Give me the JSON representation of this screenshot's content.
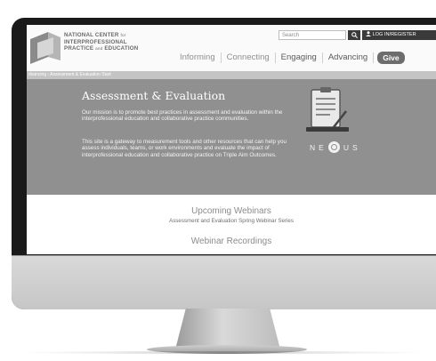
{
  "header": {
    "org_name": {
      "line1": "NATIONAL CENTER",
      "line1_small": "for",
      "line2": "INTERPROFESSIONAL",
      "line3a": "PRACTICE",
      "line3_small": "and",
      "line3b": "EDUCATION"
    },
    "search": {
      "placeholder": "Search",
      "icon": "search-icon"
    },
    "login_label": "LOG IN/REGISTER",
    "login_icon": "user-icon"
  },
  "nav": {
    "items": [
      {
        "label": "Informing"
      },
      {
        "label": "Connecting"
      },
      {
        "label": "Engaging"
      },
      {
        "label": "Advancing"
      }
    ],
    "give_label": "Give"
  },
  "breadcrumb": "dvancing › Assessment & Evaluation Start",
  "hero": {
    "title": "Assessment & Evaluation",
    "paragraph1": "Our mission is to promote best practices in assessment and evaluation within the interprofessional education and collaborative practice communities.",
    "paragraph2": "This site is a gateway to measurement tools and other resources that can help you assess individuals, teams, or work environments and evaluate the impact of interprofessional education and collaborative practice on Triple Aim Outcomes.",
    "nexus": {
      "left": "NE",
      "right": "US"
    },
    "icon": "clipboard-icon"
  },
  "sections": {
    "webinars_title": "Upcoming Webinars",
    "webinars_sub": "Assessment and Evaluation Spring Webinar Series",
    "recordings_title": "Webinar Recordings"
  },
  "colors": {
    "hero_bg": "#909090",
    "bezel": "#1a1a1a",
    "give_bg": "#6d6d6d",
    "header_btn": "#3a3a3a"
  }
}
